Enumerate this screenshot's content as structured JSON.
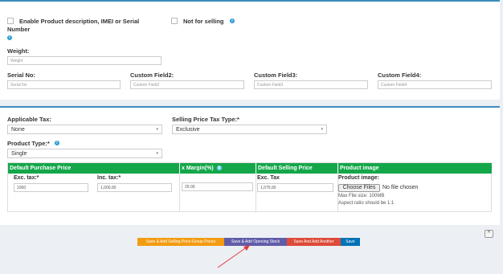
{
  "product_info": {
    "enable_desc_label_line1": "Enable Product description, IMEI or Serial",
    "enable_desc_label_line2": "Number",
    "not_for_selling_label": "Not for selling",
    "weight_label": "Weight:",
    "weight_placeholder": "Weight",
    "serial_label": "Serial No:",
    "serial_placeholder": "Serial No",
    "custom2_label": "Custom Field2:",
    "custom2_placeholder": "Custom Field2",
    "custom3_label": "Custom Field3:",
    "custom3_placeholder": "Custom Field3",
    "custom4_label": "Custom Field4:",
    "custom4_placeholder": "Custom Field4"
  },
  "tax": {
    "applicable_tax_label": "Applicable Tax:",
    "applicable_tax_value": "None",
    "selling_tax_type_label": "Selling Price Tax Type:*",
    "selling_tax_type_value": "Exclusive",
    "product_type_label": "Product Type:*",
    "product_type_value": "Single"
  },
  "pricing_table": {
    "headers": [
      "Default Purchase Price",
      "x Margin(%)",
      "Default Selling Price",
      "Product image"
    ],
    "exc_tax_label": "Exc. tax:*",
    "exc_tax_value": "1000",
    "inc_tax_label": "Inc. tax:*",
    "inc_tax_value": "1,000.00",
    "margin_value": "25.00",
    "selling_exc_label": "Exc. Tax",
    "selling_exc_value": "1,075.00",
    "image_label": "Product image:",
    "choose_files_label": "Choose Files",
    "no_file_text": "No file chosen",
    "max_size_text": "Max File size: 100MB",
    "aspect_text": "Aspect ratio should be 1:1"
  },
  "actions": {
    "save_group_prices": "Save & Add Selling-Price-Group Prices",
    "save_opening_stock": "Save & Add Opening Stock",
    "save_add_another": "Save And Add Another",
    "save": "Save",
    "scroll_up": "^"
  },
  "colors": {
    "accent": "#3c8dbc",
    "table_header": "#14a74a",
    "btn_orange": "#f39c12",
    "btn_purple": "#605ca8",
    "btn_red": "#dd4b39",
    "btn_blue": "#0073b7",
    "arrow": "#e53935"
  },
  "icons": [
    "checkbox-icon",
    "info-icon",
    "chevron-down-icon",
    "arrow-pointer-icon",
    "chevron-up-icon"
  ]
}
